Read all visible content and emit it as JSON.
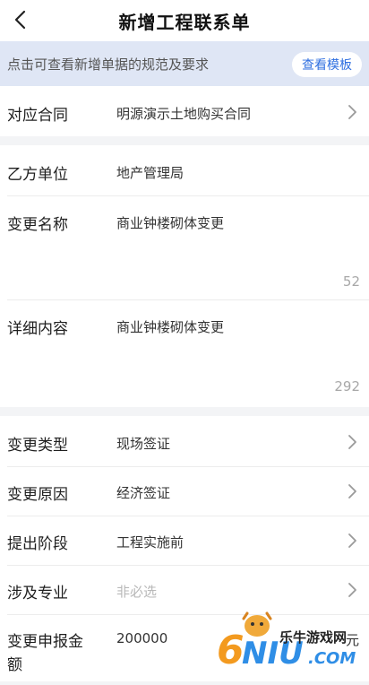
{
  "header": {
    "title": "新增工程联系单"
  },
  "tip": {
    "text": "点击可查看新增单据的规范及要求",
    "button_label": "查看模板"
  },
  "form": {
    "contract": {
      "label": "对应合同",
      "value": "明源演示土地购买合同"
    },
    "party_b": {
      "label": "乙方单位",
      "value": "地产管理局"
    },
    "change_name": {
      "label": "变更名称",
      "value": "商业钟楼砌体变更",
      "counter": "52"
    },
    "details": {
      "label": "详细内容",
      "value": "商业钟楼砌体变更",
      "counter": "292"
    },
    "change_type": {
      "label": "变更类型",
      "value": "现场签证"
    },
    "change_reason": {
      "label": "变更原因",
      "value": "经济签证"
    },
    "stage": {
      "label": "提出阶段",
      "value": "工程实施前"
    },
    "specialty": {
      "label": "涉及专业",
      "placeholder": "非必选"
    },
    "amount": {
      "label_line1": "变更申报金",
      "label_line2": "额",
      "value": "200000",
      "unit": "元"
    }
  },
  "watermark": {
    "brand": "乐牛游戏网",
    "logo_text": "6NIU.COM"
  },
  "colors": {
    "accent": "#2f6fe0",
    "tip_bg": "#dfe6f5",
    "page_bg": "#f3f4f6"
  }
}
